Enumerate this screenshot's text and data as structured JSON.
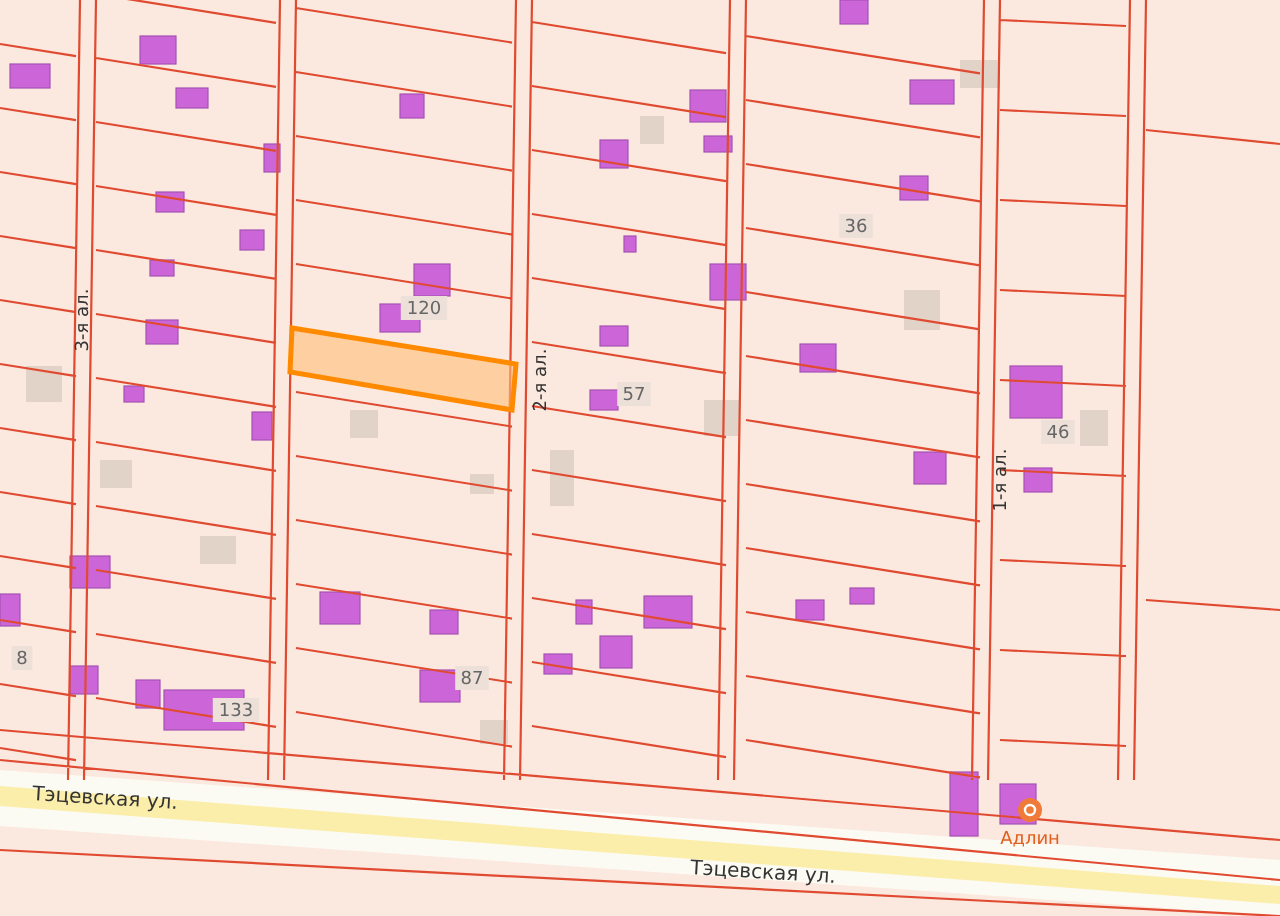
{
  "map": {
    "alleys": [
      {
        "label": "3-я ал."
      },
      {
        "label": "2-я ал."
      },
      {
        "label": "1-я ал."
      }
    ],
    "streets": [
      {
        "label": "Тэцевская ул."
      },
      {
        "label": "Тэцевская ул."
      }
    ],
    "house_numbers": [
      "120",
      "57",
      "36",
      "46",
      "87",
      "133",
      "8"
    ],
    "poi": {
      "label": "Адлин"
    },
    "highlighted_parcel": {
      "selected": true
    }
  }
}
